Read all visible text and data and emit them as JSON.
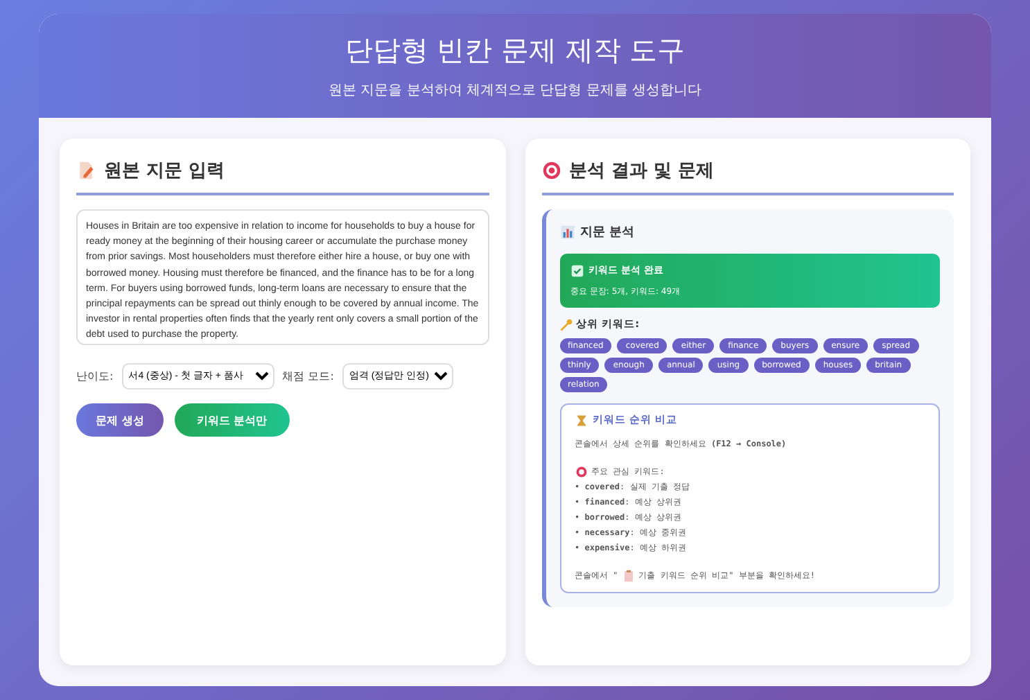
{
  "header": {
    "title": "단답형 빈칸 문제 제작 도구",
    "subtitle": "원본 지문을 분석하여 체계적으로 단답형 문제를 생성합니다"
  },
  "input_panel": {
    "title": "원본 지문 입력",
    "passage": "Houses in Britain are too expensive in relation to income for households to buy a house for ready money at the beginning of their housing career or accumulate the purchase money from prior savings. Most householders must therefore either hire a house, or buy one with borrowed money. Housing must therefore be financed, and the finance has to be for a long term. For buyers using borrowed funds, long-term loans are necessary to ensure that the principal repayments can be spread out thinly enough to be covered by annual income. The investor in rental properties often finds that the yearly rent only covers a small portion of the debt used to purchase the property.",
    "difficulty": {
      "label": "난이도:",
      "value": "서4 (중상) - 첫 글자 + 품사"
    },
    "grading": {
      "label": "채점 모드:",
      "value": "엄격 (정답만 인정)"
    },
    "buttons": [
      {
        "label": "문제 생성",
        "kind": "primary"
      },
      {
        "label": "키워드 분석만",
        "kind": "success"
      }
    ]
  },
  "result_panel": {
    "title": "분석 결과 및 문제",
    "analysis_title": "지문 분석",
    "status": {
      "title": "키워드 분석 완료",
      "detail": "중요 문장: 5개, 키워드: 49개"
    },
    "keywords_label": "상위 키워드:",
    "keywords": [
      "financed",
      "covered",
      "either",
      "finance",
      "buyers",
      "ensure",
      "spread",
      "thinly",
      "enough",
      "annual",
      "using",
      "borrowed",
      "houses",
      "britain",
      "relation"
    ],
    "ranking": {
      "title": "키워드 순위 비교",
      "intro": "콘솔에서 상세 순위를 확인하세요 **(F12 → Console)**",
      "focus_label": "주요 관심 키워드:",
      "items": [
        "• **covered**: 실제 기출 정답",
        "• **financed**: 예상 상위권",
        "• **borrowed**: 예상 상위권",
        "• **necessary**: 예상 중위권",
        "• **expensive**: 예상 하위권"
      ],
      "footer_before": "콘솔에서 \"",
      "footer_after": "기출 키워드 순위 비교\" 부분을 확인하세요!"
    }
  }
}
